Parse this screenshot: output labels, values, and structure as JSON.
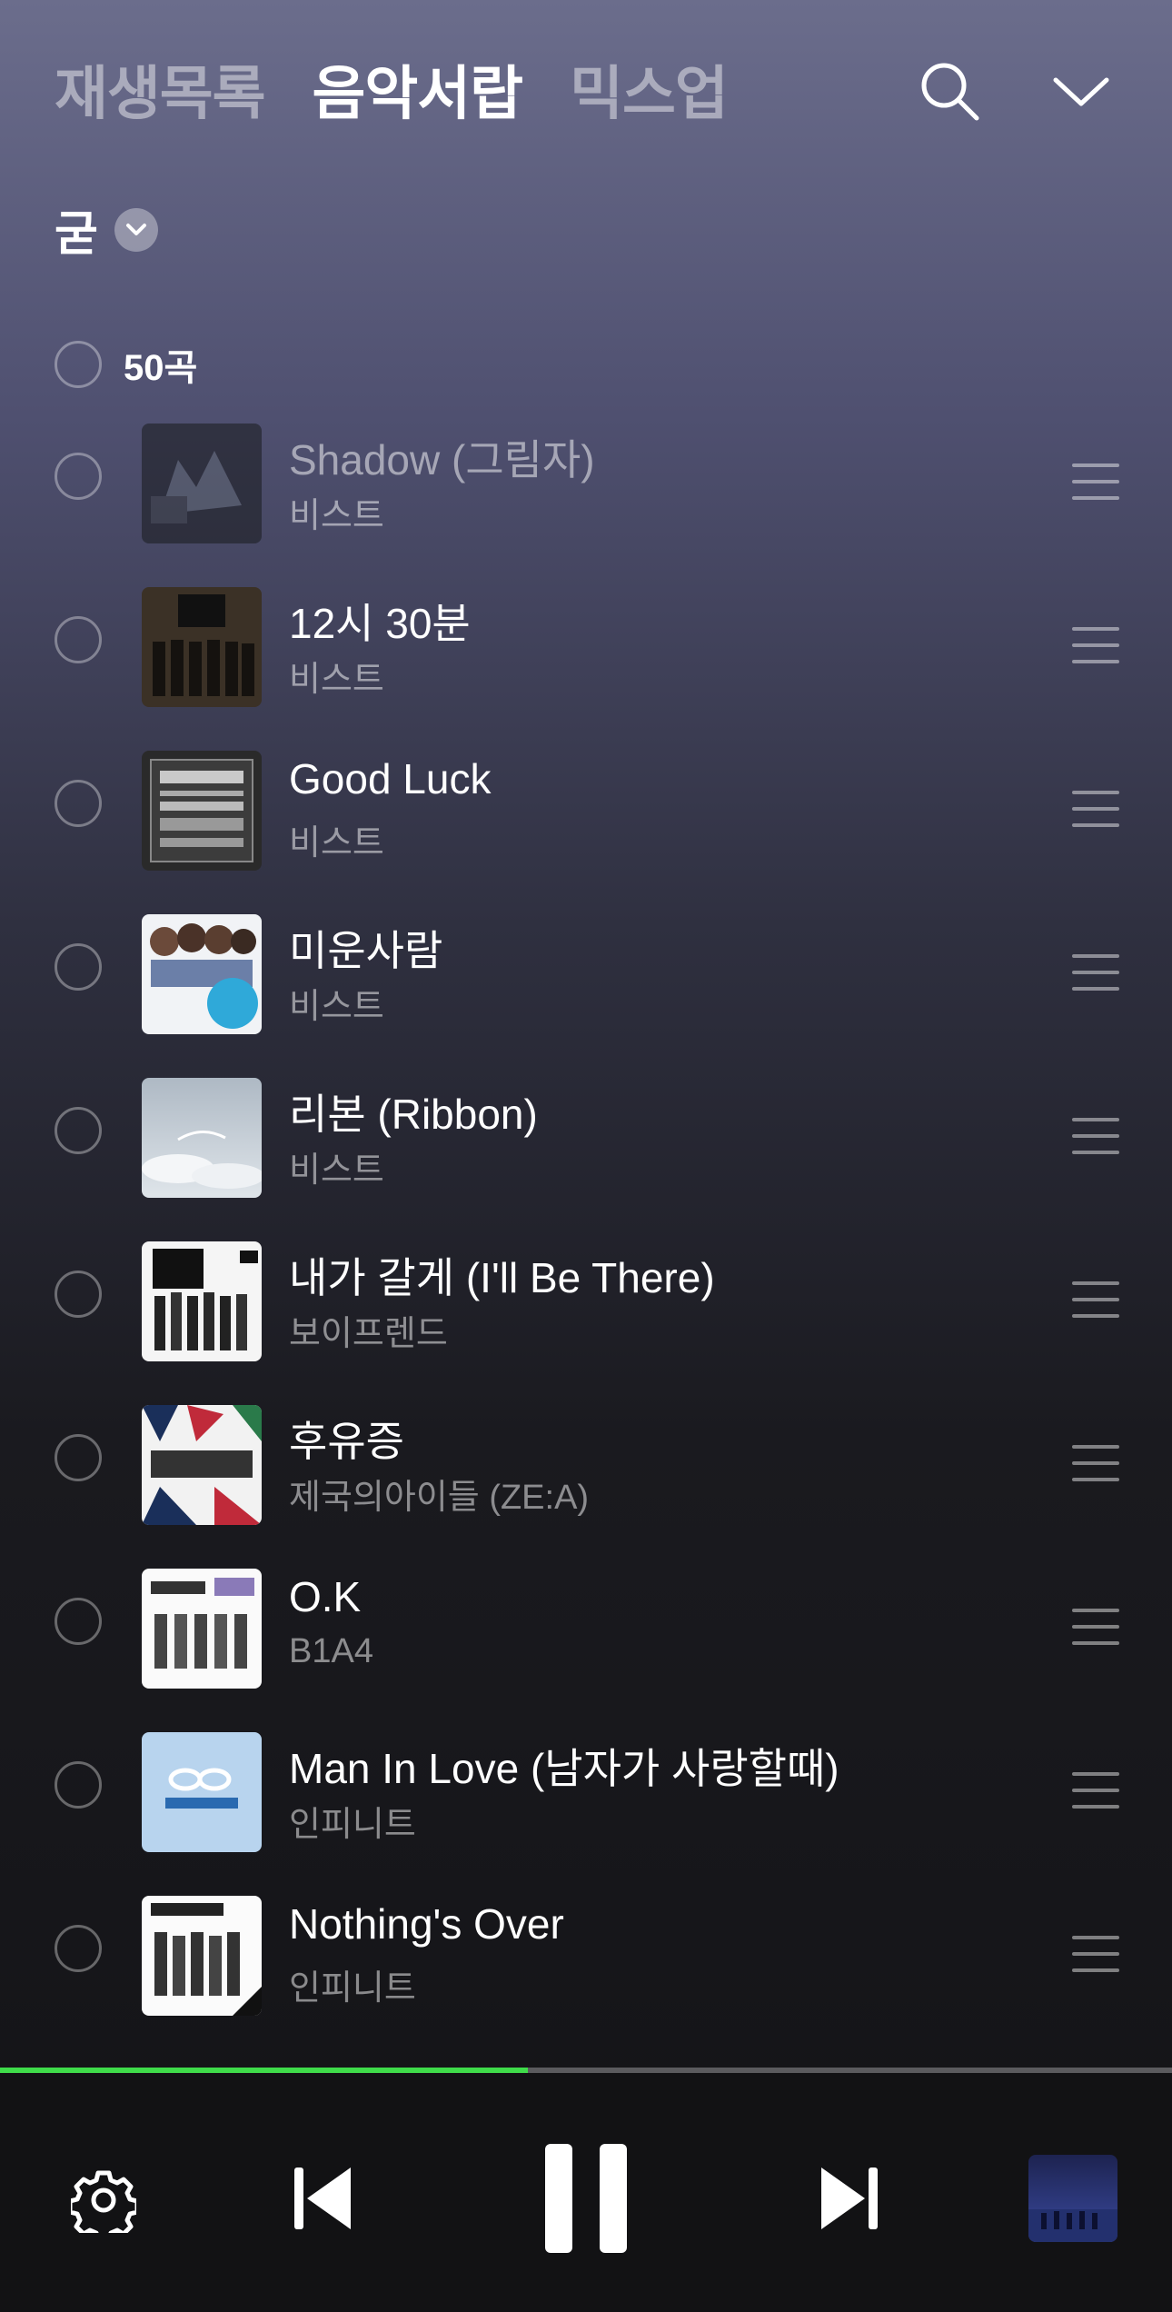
{
  "tabs": [
    {
      "label": "재생목록"
    },
    {
      "label": "음악서랍"
    },
    {
      "label": "믹스업"
    }
  ],
  "icons": {
    "search": "search-icon",
    "collapse": "chevron-down-icon",
    "settings": "gear-icon",
    "prev": "skip-previous-icon",
    "pause": "pause-icon",
    "next": "skip-next-icon",
    "handle": "drag-handle-icon"
  },
  "filter": {
    "label": "굳"
  },
  "select_all": {
    "count_label": "50곡"
  },
  "songs": [
    {
      "title": "Shadow (그림자)",
      "artist": "비스트"
    },
    {
      "title": "12시 30분",
      "artist": "비스트"
    },
    {
      "title": "Good Luck",
      "artist": "비스트"
    },
    {
      "title": "미운사람",
      "artist": "비스트"
    },
    {
      "title": "리본 (Ribbon)",
      "artist": "비스트"
    },
    {
      "title": "내가 갈게 (I'll Be There)",
      "artist": "보이프렌드"
    },
    {
      "title": "후유증",
      "artist": "제국의아이들 (ZE:A)"
    },
    {
      "title": "O.K",
      "artist": "B1A4"
    },
    {
      "title": "Man In Love (남자가 사랑할때)",
      "artist": "인피니트"
    },
    {
      "title": "Nothing's Over",
      "artist": "인피니트"
    }
  ],
  "player": {
    "progress": 0.45
  },
  "colors": {
    "accent": "#3fdc4a"
  }
}
